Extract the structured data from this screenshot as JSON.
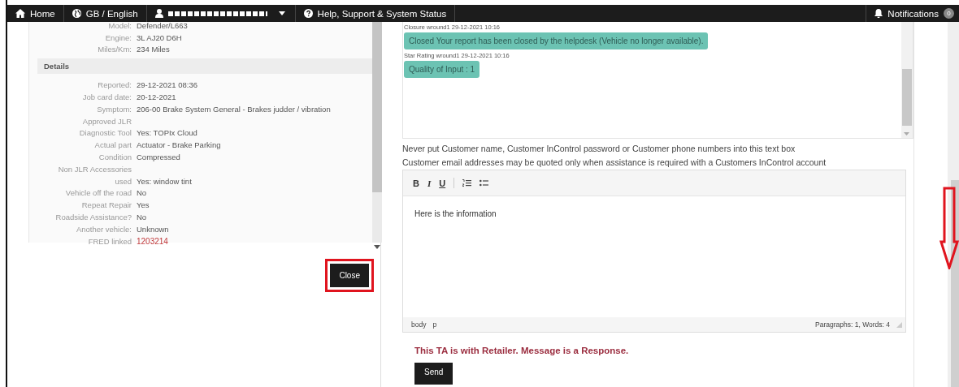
{
  "nav": {
    "items": [
      {
        "kind": "home",
        "label": "Home"
      },
      {
        "kind": "globe",
        "label": "GB / English"
      },
      {
        "kind": "user",
        "redacted": true
      },
      {
        "kind": "help",
        "label": "Help, Support & System Status"
      }
    ],
    "notifications": {
      "label": "Notifications",
      "count": "0"
    }
  },
  "vehicle": [
    {
      "label": "Model:",
      "value": "Defender/L663"
    },
    {
      "label": "Engine:",
      "value": "3L AJ20 D6H"
    },
    {
      "label": "Miles/Km:",
      "value": "234 Miles"
    }
  ],
  "details": {
    "heading": "Details",
    "rows": [
      {
        "label": "Reported:",
        "value": "29-12-2021 08:36"
      },
      {
        "label": "Job card date:",
        "value": "20-12-2021"
      },
      {
        "label": "Symptom:",
        "value": "206-00 Brake System General - Brakes judder / vibration"
      },
      {
        "label": "Approved JLR"
      },
      {
        "label": "Diagnostic Tool",
        "value": "Yes: TOPIx Cloud"
      },
      {
        "label": "Actual part",
        "value": "Actuator - Brake Parking"
      },
      {
        "label": "Condition",
        "value": "Compressed"
      },
      {
        "label": "Non JLR Accessories"
      },
      {
        "label": "used",
        "value": "Yes: window tint"
      },
      {
        "label": "Vehicle off the road",
        "value": "No"
      },
      {
        "label": "Repeat Repair",
        "value": "Yes"
      },
      {
        "label": "Roadside Assistance?",
        "value": "No"
      },
      {
        "label": "Another vehicle:",
        "value": "Unknown"
      },
      {
        "label": "FRED linked",
        "value": "1203214",
        "kind": "link"
      }
    ]
  },
  "close_button": {
    "label": "Close",
    "highlighted": true
  },
  "messages": [
    {
      "header": "Closure wround1 29-12-2021 10:16",
      "text": "Closed Your report has been closed by the helpdesk (Vehicle no longer available)."
    },
    {
      "header": "Star Rating wround1 29-12-2021 10:16",
      "text": "Quality of Input : 1"
    }
  ],
  "notices": [
    "Never put Customer name, Customer InControl password or Customer phone numbers into this text box",
    "Customer email addresses may be quoted only when assistance is required with a Customers InControl account"
  ],
  "editor": {
    "toolbar": [
      {
        "kind": "bold",
        "label": "B"
      },
      {
        "kind": "italic",
        "label": "I"
      },
      {
        "kind": "underline",
        "label": "U"
      },
      {
        "kind": "numbered-list"
      },
      {
        "kind": "bullet-list"
      }
    ],
    "content": "Here is the information",
    "path": [
      "body",
      "p"
    ],
    "word_count": "Paragraphs: 1, Words: 4"
  },
  "status_message": "This TA is with Retailer. Message is a Response.",
  "send_button": "Send",
  "annotation_arrow": true
}
